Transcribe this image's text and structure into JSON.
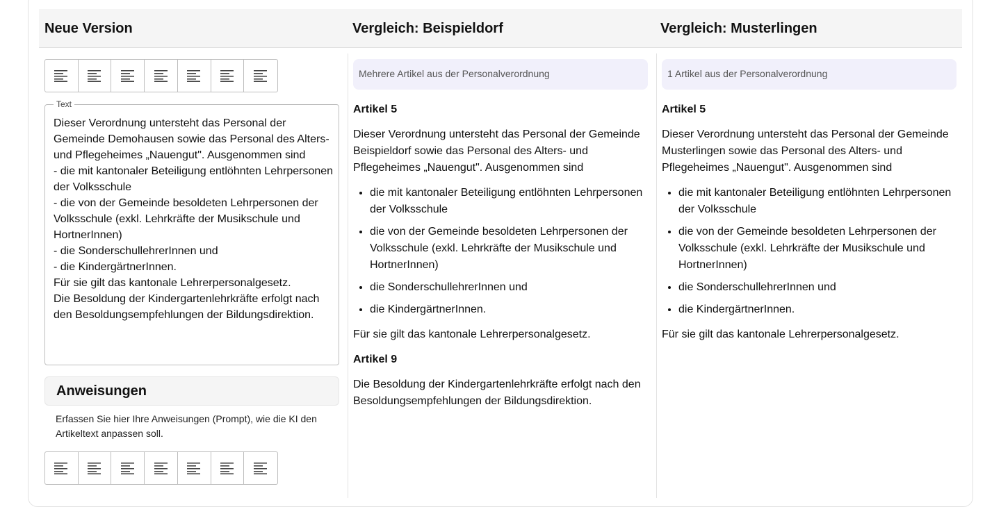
{
  "columns": {
    "new_version": "Neue Version",
    "compare_a": "Vergleich: Beispieldorf",
    "compare_b": "Vergleich: Musterlingen"
  },
  "editor": {
    "legend": "Text",
    "text": "Dieser Verordnung untersteht das Personal der Gemeinde Demohausen sowie das Personal des Alters- und Pflegeheimes „Nauengut\". Ausgenommen sind\n- die mit kantonaler Beteiligung entlöhnten Lehrpersonen der Volksschule\n- die von der Gemeinde besoldeten Lehrpersonen der Volksschule (exkl. Lehrkräfte der Musikschule und HortnerInnen)\n- die SonderschullehrerInnen und\n- die KindergärtnerInnen.\nFür sie gilt das kantonale Lehrerpersonalgesetz.\nDie Besoldung der Kindergartenlehrkräfte erfolgt nach den Besoldungsempfehlungen der Bildungsdirektion."
  },
  "toolbar": {
    "icons": [
      "align-left-icon",
      "align-left-icon",
      "align-left-icon",
      "align-left-icon",
      "align-left-icon",
      "align-left-icon",
      "align-left-icon"
    ]
  },
  "instructions": {
    "title": "Anweisungen",
    "description": "Erfassen Sie hier Ihre Anweisungen (Prompt), wie die KI den Artikeltext anpassen soll."
  },
  "compare_a": {
    "banner": "Mehrere Artikel aus der Personalverordnung",
    "article1_title": "Artikel 5",
    "article1_intro": "Dieser Verordnung untersteht das Personal der Gemeinde Beispieldorf sowie das Personal des Alters- und Pflegeheimes „Nauengut\". Ausgenommen sind",
    "article1_items": [
      "die mit kantonaler Beteiligung entlöhnten Lehrpersonen der Volksschule",
      "die von der Gemeinde besoldeten Lehrpersonen der Volksschule (exkl. Lehrkräfte der Musikschule und HortnerInnen)",
      "die SonderschullehrerInnen und",
      "die KindergärtnerInnen."
    ],
    "article1_outro": "Für sie gilt das kantonale Lehrerpersonalgesetz.",
    "article2_title": "Artikel 9",
    "article2_text": "Die Besoldung der Kindergartenlehrkräfte erfolgt nach den Besoldungsempfehlungen der Bildungsdirektion."
  },
  "compare_b": {
    "banner": "1 Artikel aus der Personalverordnung",
    "article1_title": "Artikel 5",
    "article1_intro": "Dieser Verordnung untersteht das Personal der Gemeinde Musterlingen sowie das Personal des Alters- und Pflegeheimes „Nauengut\". Ausgenommen sind",
    "article1_items": [
      "die mit kantonaler Beteiligung entlöhnten Lehrpersonen der Volksschule",
      "die von der Gemeinde besoldeten Lehrpersonen der Volksschule (exkl. Lehrkräfte der Musikschule und HortnerInnen)",
      "die SonderschullehrerInnen und",
      "die KindergärtnerInnen."
    ],
    "article1_outro": "Für sie gilt das kantonale Lehrerpersonalgesetz."
  }
}
